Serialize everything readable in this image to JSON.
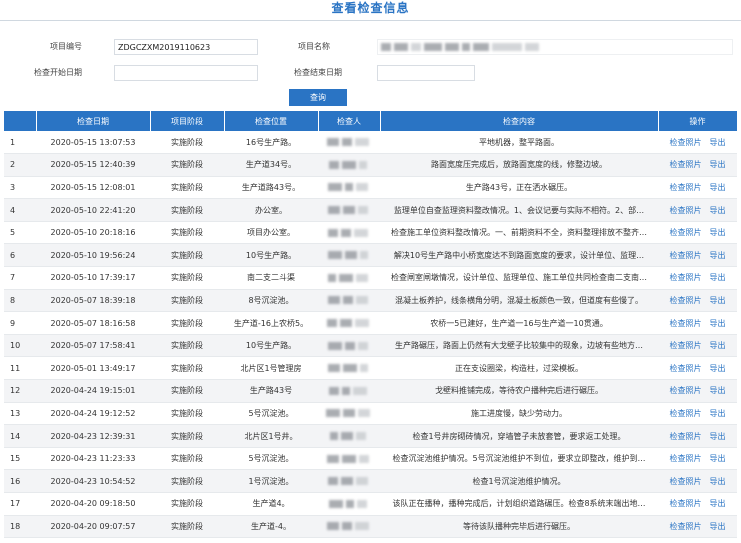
{
  "page": {
    "title": "查看检查信息"
  },
  "form": {
    "project_code_label": "项目编号",
    "project_code_value": "ZDGCZXM2019110623",
    "project_name_label": "项目名称",
    "start_date_label": "检查开始日期",
    "end_date_label": "检查结束日期",
    "query_label": "查询"
  },
  "table": {
    "headers": [
      "",
      "检查日期",
      "项目阶段",
      "检查位置",
      "检查人",
      "检查内容",
      "操作"
    ],
    "photo_label": "检查照片",
    "export_label": "导出",
    "rows": [
      {
        "idx": "1",
        "date": "2020-05-15 13:07:53",
        "stage": "实施阶段",
        "location": "16号生产路。",
        "content": "平地机器，整平路面。"
      },
      {
        "idx": "2",
        "date": "2020-05-15 12:40:39",
        "stage": "实施阶段",
        "location": "生产道34号。",
        "content": "路面宽度压完成后，放路面宽度的线，修整边坡。"
      },
      {
        "idx": "3",
        "date": "2020-05-15 12:08:01",
        "stage": "实施阶段",
        "location": "生产道路43号。",
        "content": "生产路43号，正在洒水碾压。"
      },
      {
        "idx": "4",
        "date": "2020-05-10 22:41:20",
        "stage": "实施阶段",
        "location": "办公室。",
        "content": "监理单位自查监理资料整改情况。1、会议记要与实际不相符。2、部…"
      },
      {
        "idx": "5",
        "date": "2020-05-10 20:18:16",
        "stage": "实施阶段",
        "location": "项目办公室。",
        "content": "检查施工单位资料整改情况。一、前期资料不全，资料整理排放不整齐…"
      },
      {
        "idx": "6",
        "date": "2020-05-10 19:56:24",
        "stage": "实施阶段",
        "location": "10号生产路。",
        "content": "解决10号生产路中小桥宽度达不到路面宽度的要求，设计单位、监理…"
      },
      {
        "idx": "7",
        "date": "2020-05-10 17:39:17",
        "stage": "实施阶段",
        "location": "南二支二斗渠",
        "content": "检查闸室闸墩情况，设计单位、监理单位、施工单位共同检查南二支南…"
      },
      {
        "idx": "8",
        "date": "2020-05-07 18:39:18",
        "stage": "实施阶段",
        "location": "8号沉淀池。",
        "content": "混凝土板养护，线条横角分明，混凝土板颜色一致，但道度有些慢了。"
      },
      {
        "idx": "9",
        "date": "2020-05-07 18:16:58",
        "stage": "实施阶段",
        "location": "生产道-16上农桥5。",
        "content": "农桥一5已建好，生产道一16与生产道一10贯通。"
      },
      {
        "idx": "10",
        "date": "2020-05-07 17:58:41",
        "stage": "实施阶段",
        "location": "10号生产路。",
        "content": "生产路碾压，路面上仍然有大戈壁子比较集中的现象，边坡有些地方…"
      },
      {
        "idx": "11",
        "date": "2020-05-01 13:49:17",
        "stage": "实施阶段",
        "location": "北片区1号管理房",
        "content": "正在支设圈梁，构造柱，过梁模板。"
      },
      {
        "idx": "12",
        "date": "2020-04-24 19:15:01",
        "stage": "实施阶段",
        "location": "生产路43号",
        "content": "戈壁料推铺完成，等待农户播种完后进行碾压。"
      },
      {
        "idx": "13",
        "date": "2020-04-24 19:12:52",
        "stage": "实施阶段",
        "location": "5号沉淀池。",
        "content": "施工进度慢，缺少劳动力。"
      },
      {
        "idx": "14",
        "date": "2020-04-23 12:39:31",
        "stage": "实施阶段",
        "location": "北片区1号井。",
        "content": "检查1号井房砌砖情况，穿墙管子未放套管，要求返工处理。"
      },
      {
        "idx": "15",
        "date": "2020-04-23 11:23:33",
        "stage": "实施阶段",
        "location": "5号沉淀池。",
        "content": "检查沉淀池维护情况。5号沉淀池维护不到位，要求立即整改，维护到…"
      },
      {
        "idx": "16",
        "date": "2020-04-23 10:54:52",
        "stage": "实施阶段",
        "location": "1号沉淀池。",
        "content": "检查1号沉淀池维护情况。"
      },
      {
        "idx": "17",
        "date": "2020-04-20 09:18:50",
        "stage": "实施阶段",
        "location": "生产道4。",
        "content": "该队正在播种，播种完成后，计划组织道路碾压。检查8系统末端出地…"
      },
      {
        "idx": "18",
        "date": "2020-04-20 09:07:57",
        "stage": "实施阶段",
        "location": "生产道-4。",
        "content": "等待该队播种完毕后进行碾压。"
      }
    ]
  }
}
